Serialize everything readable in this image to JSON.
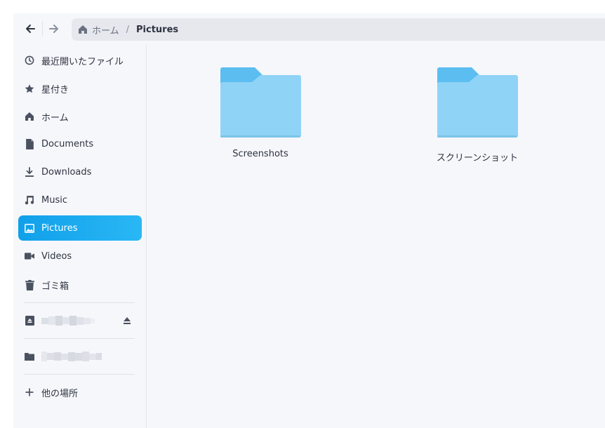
{
  "header": {
    "back_icon": "arrow-left-icon",
    "forward_icon": "arrow-right-icon",
    "path": {
      "home_label": "ホーム",
      "separator": "/",
      "current": "Pictures"
    }
  },
  "sidebar": {
    "items": [
      {
        "label": "最近開いたファイル",
        "icon": "clock-icon"
      },
      {
        "label": "星付き",
        "icon": "star-icon"
      },
      {
        "label": "ホーム",
        "icon": "home-icon"
      },
      {
        "label": "Documents",
        "icon": "document-icon"
      },
      {
        "label": "Downloads",
        "icon": "download-icon"
      },
      {
        "label": "Music",
        "icon": "music-icon"
      },
      {
        "label": "Pictures",
        "icon": "image-icon",
        "active": true
      },
      {
        "label": "Videos",
        "icon": "video-icon"
      },
      {
        "label": "ゴミ箱",
        "icon": "trash-icon"
      }
    ],
    "other_locations": "他の場所"
  },
  "content": {
    "folders": [
      {
        "name": "Screenshots"
      },
      {
        "name": "スクリーンショット"
      }
    ]
  },
  "colors": {
    "accent": "#1aa9ee",
    "folder_front": "#8fd3f7",
    "folder_back": "#5bbdf0",
    "icon": "#4a5160"
  }
}
